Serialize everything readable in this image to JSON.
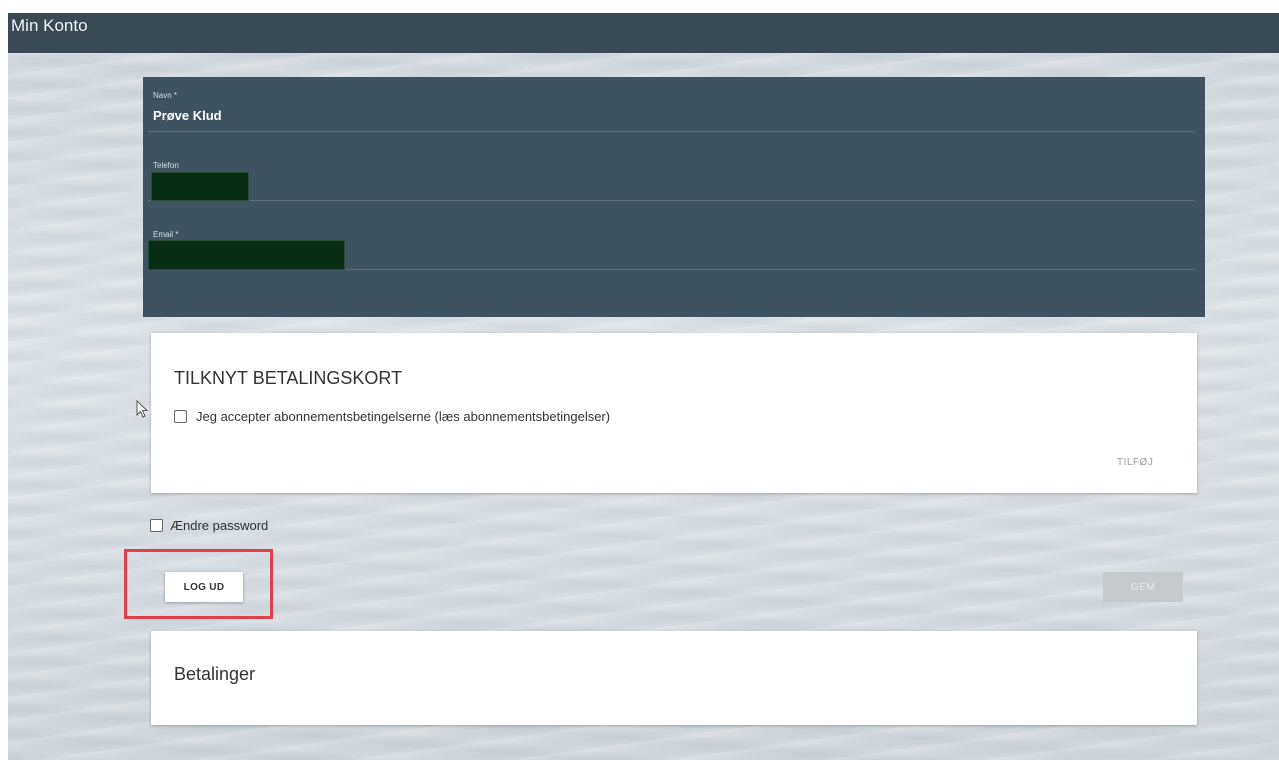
{
  "header": {
    "title": "Min Konto"
  },
  "form": {
    "name_label": "Navn *",
    "name_value": "Prøve Klud",
    "phone_label": "Telefon",
    "email_label": "Email *"
  },
  "payment_card": {
    "title": "TILKNYT BETALINGSKORT",
    "accept_terms_label": "Jeg accepter abonnementsbetingelserne (læs abonnementsbetingelser)",
    "add_button": "TILFØJ"
  },
  "change_password_label": "Ændre password",
  "logout_button": "LOG UD",
  "save_button": "GEM",
  "payments_card": {
    "title": "Betalinger"
  },
  "colors": {
    "topbar": "#394a55",
    "form_panel": "#3e5260",
    "highlight": "#e0404c",
    "redaction": "#062e14"
  }
}
